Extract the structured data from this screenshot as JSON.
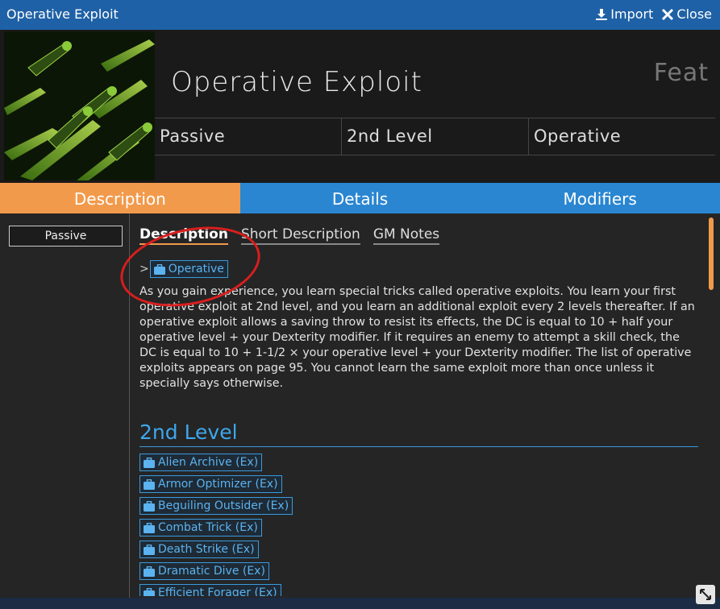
{
  "window": {
    "title": "Operative Exploit",
    "import_label": "Import",
    "close_label": "Close"
  },
  "item": {
    "name": "Operative Exploit",
    "type": "Feat",
    "properties": [
      "Passive",
      "2nd Level",
      "Operative"
    ]
  },
  "tabs": [
    {
      "label": "Description",
      "active": true
    },
    {
      "label": "Details",
      "active": false
    },
    {
      "label": "Modifiers",
      "active": false
    }
  ],
  "sidebar": {
    "chip": "Passive"
  },
  "subtabs": [
    {
      "label": "Description",
      "active": true
    },
    {
      "label": "Short Description",
      "active": false
    },
    {
      "label": "GM Notes",
      "active": false
    }
  ],
  "breadcrumb": {
    "prefix": ">",
    "link": "Operative"
  },
  "description": "As you gain experience, you learn special tricks called operative exploits. You learn your first operative exploit at 2nd level, and you learn an additional exploit every 2 levels thereafter. If an operative exploit allows a saving throw to resist its effects, the DC is equal to 10 + half your operative level + your Dexterity modifier. If it requires an enemy to attempt a skill check, the DC is equal to 10 + 1-1/2 × your operative level + your Dexterity modifier. The list of operative exploits appears on page 95. You cannot learn the same exploit more than once unless it specially says otherwise.",
  "level_heading": "2nd Level",
  "exploits": [
    "Alien Archive (Ex)",
    "Armor Optimizer (Ex)",
    "Beguiling Outsider (Ex)",
    "Combat Trick (Ex)",
    "Death Strike (Ex)",
    "Dramatic Dive (Ex)",
    "Efficient Forager (Ex)"
  ],
  "colors": {
    "accent_orange": "#f29a4c",
    "accent_blue": "#2a86d1",
    "titlebar": "#1f61a6",
    "annotation_red": "#d81e1e"
  },
  "icons": [
    "download-icon",
    "close-x-icon",
    "briefcase-icon",
    "resize-icon"
  ]
}
